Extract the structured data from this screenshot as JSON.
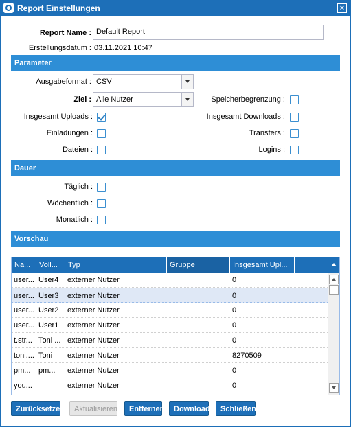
{
  "window": {
    "title": "Report Einstellungen",
    "close_symbol": "×"
  },
  "form": {
    "report_name_label": "Report Name :",
    "report_name_value": "Default Report",
    "created_label": "Erstellungsdatum :",
    "created_value": "03.11.2021 10:47"
  },
  "parameter": {
    "header": "Parameter",
    "format_label": "Ausgabeformat :",
    "format_value": "CSV",
    "target_label": "Ziel :",
    "target_value": "Alle Nutzer",
    "checkboxes": [
      {
        "label": "Speicherbegrenzung :",
        "checked": false
      },
      {
        "label": "Insgesamt Uploads :",
        "checked": true
      },
      {
        "label": "Insgesamt Downloads :",
        "checked": false
      },
      {
        "label": "Einladungen :",
        "checked": false
      },
      {
        "label": "Transfers :",
        "checked": false
      },
      {
        "label": "Dateien :",
        "checked": false
      },
      {
        "label": "Logins :",
        "checked": false
      }
    ]
  },
  "dauer": {
    "header": "Dauer",
    "options": [
      {
        "label": "Täglich :",
        "checked": false
      },
      {
        "label": "Wöchentlich :",
        "checked": false
      },
      {
        "label": "Monatlich :",
        "checked": false
      }
    ]
  },
  "vorschau": {
    "header": "Vorschau",
    "columns": [
      "Na...",
      "Voll...",
      "Typ",
      "Gruppe",
      "Insgesamt Upl..."
    ],
    "rows": [
      [
        "user...",
        "User4",
        "externer Nutzer",
        "",
        "0"
      ],
      [
        "user...",
        "User3",
        "externer Nutzer",
        "",
        "0"
      ],
      [
        "user...",
        "User2",
        "externer Nutzer",
        "",
        "0"
      ],
      [
        "user...",
        "User1",
        "externer Nutzer",
        "",
        "0"
      ],
      [
        "t.str...",
        "Toni ...",
        "externer Nutzer",
        "",
        "0"
      ],
      [
        "toni....",
        "Toni",
        "externer Nutzer",
        "",
        "8270509"
      ],
      [
        "pm...",
        "pm...",
        "externer Nutzer",
        "",
        "0"
      ],
      [
        "you...",
        "",
        "externer Nutzer",
        "",
        "0"
      ]
    ],
    "selected_row": 1
  },
  "buttons": {
    "reset": "Zurücksetzen",
    "refresh": "Aktualisieren",
    "remove": "Entfernen",
    "download": "Download",
    "close": "Schließen"
  },
  "colors": {
    "accent": "#1d6fb8",
    "section_header": "#2e8ed6",
    "selected_row": "#dfe8f6"
  }
}
